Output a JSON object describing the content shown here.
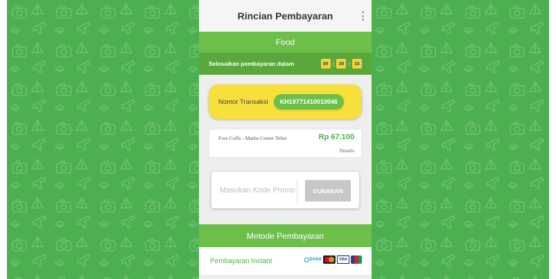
{
  "colors": {
    "background_green": "#4caf50",
    "band_green": "#6cc04a",
    "timer_green": "#5aa83c",
    "yellow": "#f7e03c",
    "price_green": "#4caf50",
    "button_disabled": "#c7c7c7"
  },
  "background": {
    "pattern_icons": [
      "camera-icon",
      "car-icon",
      "ship-icon",
      "map-pin-icon",
      "airplane-icon",
      "bicycle-icon",
      "bus-icon",
      "compass-icon",
      "sailboat-icon",
      "cable-car-icon",
      "luggage-icon"
    ]
  },
  "header": {
    "title": "Rincian Pembayaran",
    "menu_icon": "kebab-menu-icon"
  },
  "category": {
    "label": "Food"
  },
  "timer": {
    "label": "Selesaikan pembayaran dalam",
    "hours": "00",
    "minutes": "29",
    "seconds": "33",
    "separator": ":"
  },
  "transaction": {
    "label": "Nomor Transaksi",
    "number": "KH19771410010046"
  },
  "order": {
    "merchant": "Fore Coffe - Marba Center Tebet",
    "price": "Rp 67.100",
    "details_link": "Details"
  },
  "promo": {
    "placeholder": "Masukan Kode Promo",
    "button_label": "GUNAKAN"
  },
  "payment": {
    "section_title": "Metode Pembayaran",
    "instant_label": "Pembayaran Instant",
    "logos": {
      "dana": "DANA",
      "visa": "VISA"
    }
  }
}
